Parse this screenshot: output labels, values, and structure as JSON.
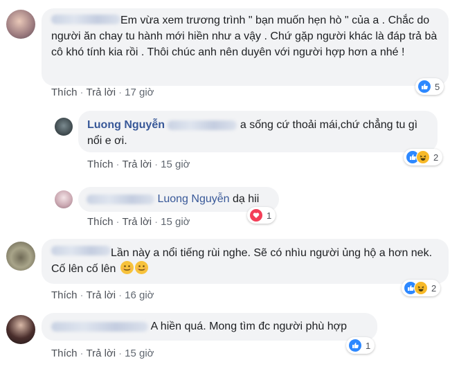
{
  "comments": [
    {
      "text": "Em vừa xem trương trình \" bạn muốn hẹn hò \" của a . Chắc do người ăn chay tu hành mới hiền như a vậy . Chứ gặp người khác là đáp trả bà cô khó tính kia rồi . Thôi chúc anh nên duyên với người hợp hơn a nhé !",
      "actions": {
        "like": "Thích",
        "reply": "Trả lời",
        "time": "17 giờ"
      },
      "reaction_count": "5"
    },
    {
      "author": "Luong Nguyễn",
      "text": "a sống cứ thoải mái,chứ chẳng tu gì nổi e ơi.",
      "actions": {
        "like": "Thích",
        "reply": "Trả lời",
        "time": "15 giờ"
      },
      "reaction_count": "2"
    },
    {
      "mention": "Luong Nguyễn",
      "text": "dạ hii",
      "actions": {
        "like": "Thích",
        "reply": "Trả lời",
        "time": "15 giờ"
      },
      "reaction_count": "1"
    },
    {
      "text": "Lần này a nổi tiếng rùi nghe. Sẽ có nhìu người ủng hộ a hơn nek. Cố lên cố lên",
      "actions": {
        "like": "Thích",
        "reply": "Trả lời",
        "time": "16 giờ"
      },
      "reaction_count": "2"
    },
    {
      "text": "A hiền quá. Mong tìm đc người phù hợp",
      "actions": {
        "like": "Thích",
        "reply": "Trả lời",
        "time": "15 giờ"
      },
      "reaction_count": "1"
    }
  ],
  "colors": {
    "name": "#385898",
    "bubble": "#f2f3f5",
    "like": "#2d88ff",
    "haha": "#f7b928",
    "love": "#f33e58"
  },
  "icons": [
    "like-icon",
    "haha-icon",
    "love-icon",
    "smile-emoji"
  ]
}
